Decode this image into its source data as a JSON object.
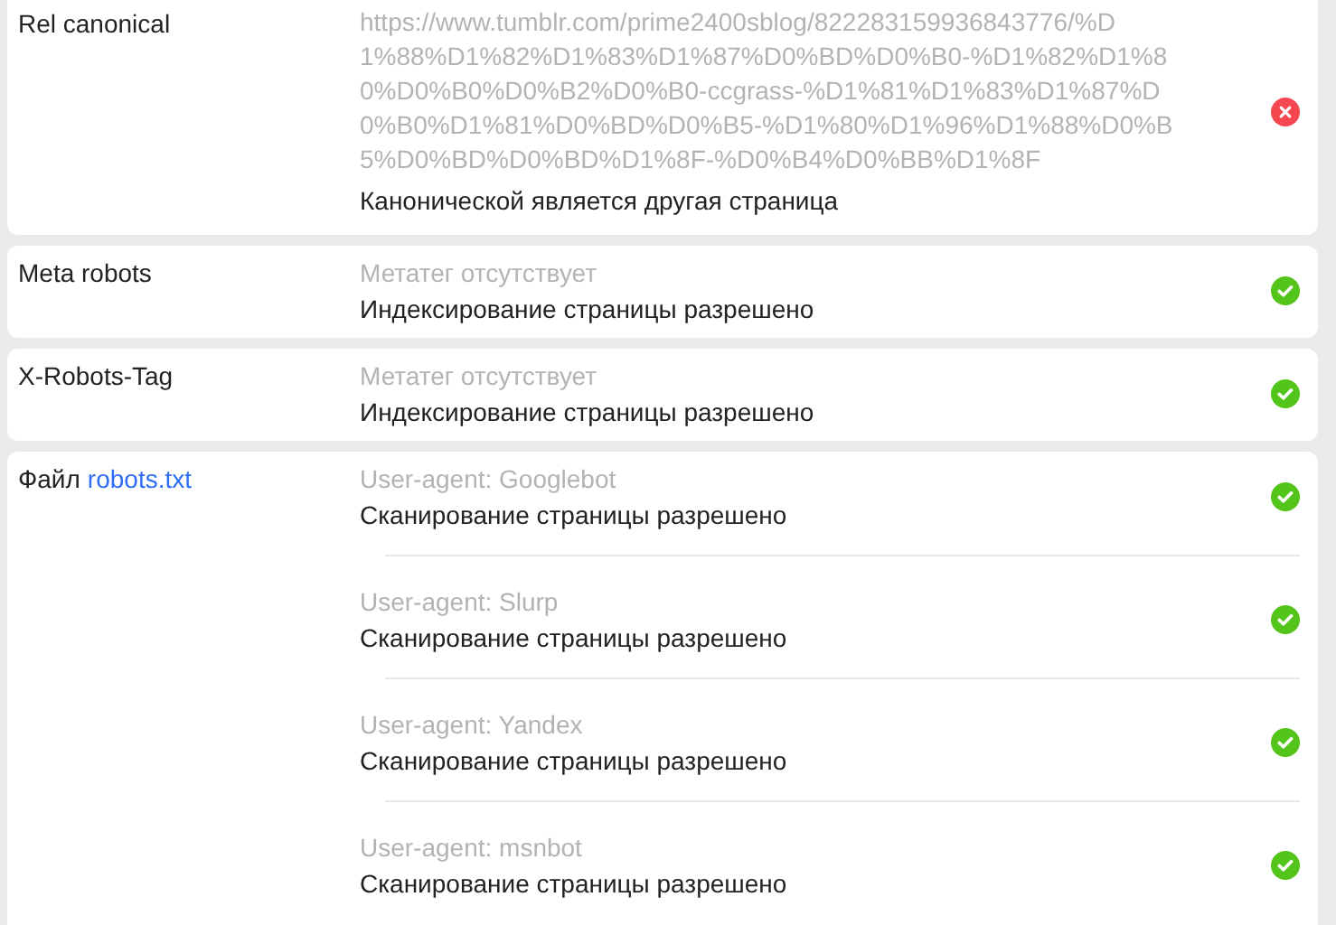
{
  "rows": [
    {
      "label": "Rel canonical",
      "items": [
        {
          "passed": false,
          "url_lines": [
            "https://www.tumblr.com/prime2400sblog/822283159936843776/%D",
            "1%88%D1%82%D1%83%D1%87%D0%BD%D0%B0-%D1%82%D1%8",
            "0%D0%B0%D0%B2%D0%B0-ccgrass-%D1%81%D1%83%D1%87%D",
            "0%B0%D1%81%D0%BD%D0%B5-%D1%80%D1%96%D1%88%D0%B",
            "5%D0%BD%D0%BD%D1%8F-%D0%B4%D0%BB%D1%8F"
          ],
          "result": "Канонической является другая страница"
        }
      ]
    },
    {
      "label": "Meta robots",
      "items": [
        {
          "passed": true,
          "detail": "Метатег отсутствует",
          "result": "Индексирование страницы разрешено"
        }
      ]
    },
    {
      "label": "X-Robots-Tag",
      "items": [
        {
          "passed": true,
          "detail": "Метатег отсутствует",
          "result": "Индексирование страницы разрешено"
        }
      ]
    },
    {
      "label": "Файл",
      "link": "robots.txt",
      "items": [
        {
          "passed": true,
          "detail": "User-agent: Googlebot",
          "result": "Сканирование страницы разрешено"
        },
        {
          "passed": true,
          "detail": "User-agent: Slurp",
          "result": "Сканирование страницы разрешено"
        },
        {
          "passed": true,
          "detail": "User-agent: Yandex",
          "result": "Сканирование страницы разрешено"
        },
        {
          "passed": true,
          "detail": "User-agent: msnbot",
          "result": "Сканирование страницы разрешено"
        }
      ]
    }
  ]
}
